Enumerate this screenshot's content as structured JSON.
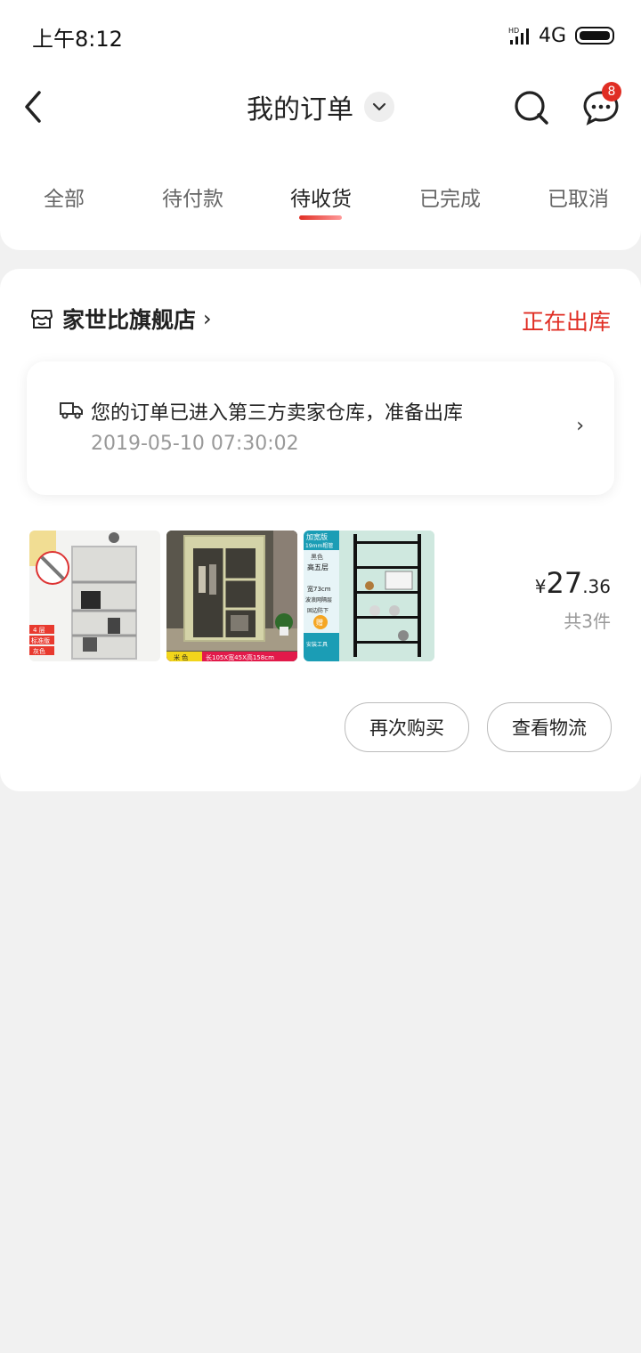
{
  "status_bar": {
    "time": "上午8:12",
    "network": "4G"
  },
  "header": {
    "title": "我的订单",
    "message_count": "8"
  },
  "tabs": [
    {
      "label": "全部"
    },
    {
      "label": "待付款"
    },
    {
      "label": "待收货",
      "active": true
    },
    {
      "label": "已完成"
    },
    {
      "label": "已取消"
    }
  ],
  "order": {
    "shop_name": "家世比旗舰店",
    "status": "正在出库",
    "logistics": {
      "message": "您的订单已进入第三方卖家仓库，准备出库",
      "time": "2019-05-10 07:30:02"
    },
    "products": [
      {
        "label_a": "4 层",
        "label_b": "标准版",
        "label_c": "灰色"
      },
      {
        "label_a": "米 色",
        "label_b": "长105X宽45X高158cm"
      },
      {
        "label_a": "加宽版",
        "label_b": "19mm粗管",
        "label_c": "黑色",
        "label_d": "高五层",
        "label_e": "宽73cm",
        "label_f": "波浪网隔层",
        "label_g": "固边防下",
        "label_h": "赠",
        "label_i": "安装工具"
      }
    ],
    "price": {
      "currency": "¥",
      "integer": "27",
      "decimal": ".36"
    },
    "count": "共3件",
    "buttons": {
      "rebuy": "再次购买",
      "track": "查看物流"
    }
  },
  "colors": {
    "accent": "#e02e24",
    "background": "#f1f1f1"
  }
}
